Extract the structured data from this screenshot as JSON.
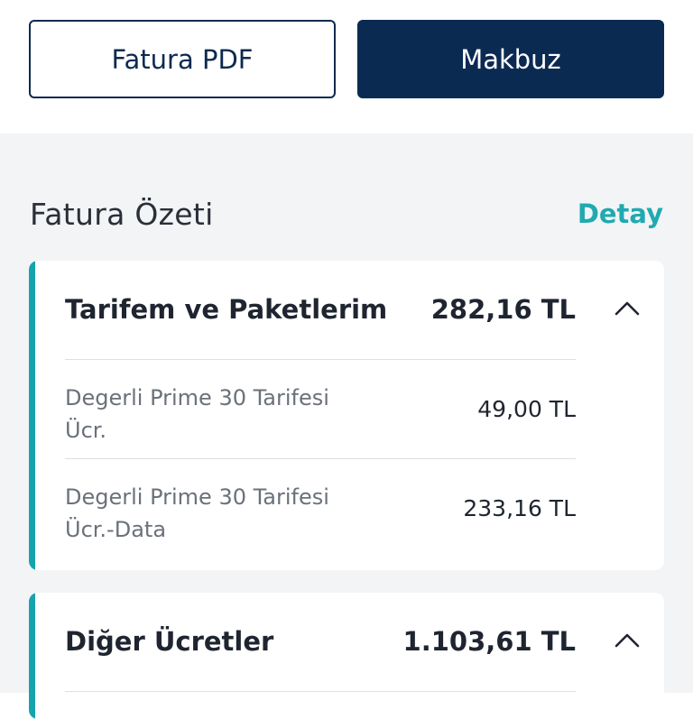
{
  "actions": {
    "invoice_pdf_label": "Fatura PDF",
    "receipt_label": "Makbuz"
  },
  "summary": {
    "title": "Fatura Özeti",
    "detail_link": "Detay"
  },
  "sections": [
    {
      "title": "Tarifem ve Paketlerim",
      "total": "282,16 TL",
      "expanded": true,
      "items": [
        {
          "label_line1": "Degerli Prime 30 Tarifesi",
          "label_line2": "Ücr.",
          "amount": "49,00 TL"
        },
        {
          "label_line1": "Degerli Prime 30 Tarifesi",
          "label_line2": "Ücr.-Data",
          "amount": "233,16 TL"
        }
      ]
    },
    {
      "title": "Diğer Ücretler",
      "total": "1.103,61 TL",
      "expanded": true
    }
  ],
  "colors": {
    "primary_navy": "#0a2a52",
    "accent_teal": "#17a3ad",
    "link_teal": "#20aab0",
    "background_grey": "#f3f4f6"
  },
  "icons": {
    "collapse": "chevron-up-icon"
  }
}
